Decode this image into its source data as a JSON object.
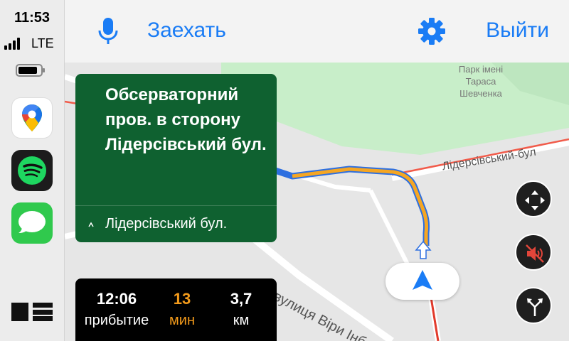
{
  "status": {
    "time": "11:53",
    "network": "LTE",
    "battery_level": 0.85
  },
  "apps": [
    {
      "name": "Google Maps",
      "icon": "google-maps-icon"
    },
    {
      "name": "Spotify",
      "icon": "spotify-icon"
    },
    {
      "name": "Messages",
      "icon": "messages-icon"
    }
  ],
  "topbar": {
    "stop_label": "Заехать",
    "exit_label": "Выйти",
    "mic_icon": "microphone-icon",
    "settings_icon": "gear-icon"
  },
  "map": {
    "park_label": "Парк імені\nТараса\nШевченка",
    "street_1": "Лідерсівський-бул",
    "street_2": "вулиця Віри Інбер"
  },
  "instruction": {
    "main": "Обсерваторний пров. в сторону Лідерсівський бул.",
    "sub": "Лідерсівський бул."
  },
  "eta": {
    "arrival_time": "12:06",
    "arrival_label": "прибытие",
    "duration": "13",
    "duration_label": "мин",
    "distance": "3,7",
    "distance_label": "км"
  },
  "controls": [
    "recenter-icon",
    "mute-icon",
    "route-options-icon"
  ],
  "colors": {
    "accent": "#1a7cf5",
    "panel_green": "#0f6130",
    "route": "#f5a623",
    "eta_orange": "#f29a1b"
  }
}
